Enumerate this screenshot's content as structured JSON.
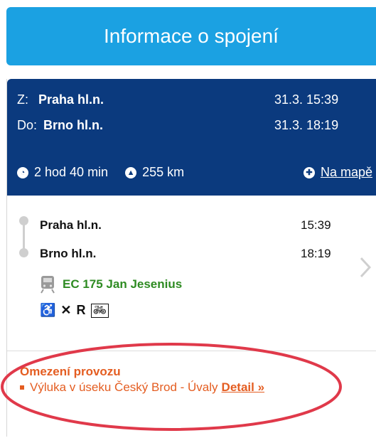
{
  "header": {
    "title": "Informace o spojení"
  },
  "summary": {
    "from_label": "Z:",
    "from_station": "Praha hl.n.",
    "from_time": "31.3. 15:39",
    "to_label": "Do:",
    "to_station": "Brno hl.n.",
    "to_time": "31.3. 18:19",
    "duration": "2 hod 40 min",
    "distance": "255 km",
    "map_link": "Na mapě"
  },
  "route": {
    "stops": [
      {
        "station": "Praha hl.n.",
        "time": "15:39"
      },
      {
        "station": "Brno hl.n.",
        "time": "18:19"
      }
    ],
    "train": "EC 175 Jan Jesenius",
    "amenities": [
      "wheelchair-icon",
      "restaurant-icon",
      "R",
      "bicycle-icon"
    ]
  },
  "notice": {
    "title": "Omezení provozu",
    "text": "Výluka v úseku Český Brod - Úvaly",
    "link": "Detail »"
  },
  "colors": {
    "header": "#1ba1e2",
    "summary": "#0b3a7e",
    "train": "#2e8b22",
    "notice": "#e45d21",
    "highlight": "#e0394a"
  }
}
